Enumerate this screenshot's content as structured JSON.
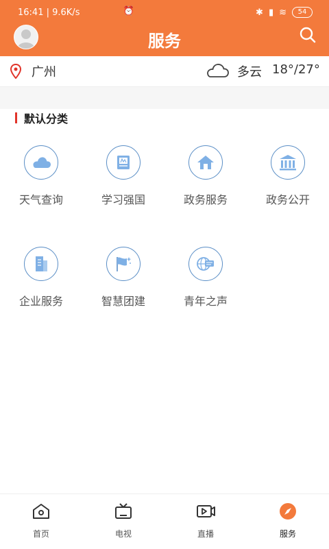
{
  "status": {
    "time_speed": "16:41 | 9.6K/s",
    "battery": "54"
  },
  "header": {
    "title": "服务"
  },
  "weather": {
    "city": "广州",
    "condition": "多云",
    "temp": "18°/27°"
  },
  "section": {
    "title": "默认分类"
  },
  "services": [
    {
      "label": "天气查询",
      "icon": "cloud-icon"
    },
    {
      "label": "学习强国",
      "icon": "book-icon"
    },
    {
      "label": "政务服务",
      "icon": "house-icon"
    },
    {
      "label": "政务公开",
      "icon": "government-building-icon"
    },
    {
      "label": "企业服务",
      "icon": "office-building-icon"
    },
    {
      "label": "智慧团建",
      "icon": "flag-icon"
    },
    {
      "label": "青年之声",
      "icon": "globe-chat-icon"
    }
  ],
  "tabs": [
    {
      "label": "首页",
      "icon": "home-icon"
    },
    {
      "label": "电视",
      "icon": "tv-icon"
    },
    {
      "label": "直播",
      "icon": "live-video-icon"
    },
    {
      "label": "服务",
      "icon": "compass-icon",
      "active": true
    }
  ],
  "colors": {
    "brand": "#f37a3c",
    "icon_blue": "#5a8ec6",
    "section_accent": "#e1342a"
  }
}
